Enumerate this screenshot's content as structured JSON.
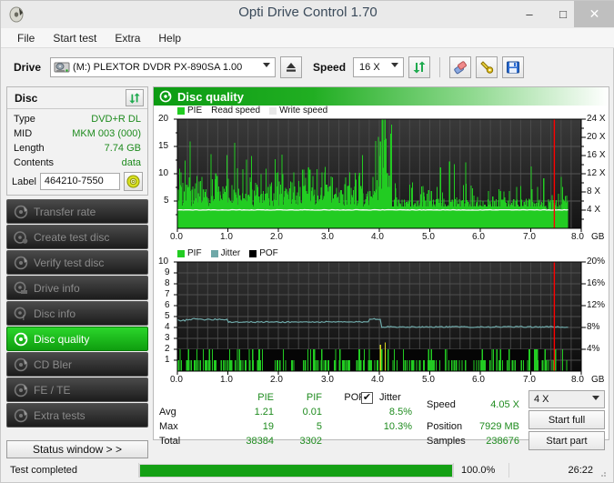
{
  "window": {
    "title": "Opti Drive Control 1.70",
    "app_icon": "disc-icon",
    "minimize": "–",
    "maximize": "□",
    "close": "✕"
  },
  "menu": {
    "items": [
      {
        "label": "File",
        "name": "menu-file"
      },
      {
        "label": "Start test",
        "name": "menu-start-test"
      },
      {
        "label": "Extra",
        "name": "menu-extra"
      },
      {
        "label": "Help",
        "name": "menu-help"
      }
    ]
  },
  "toolbar": {
    "drive_label": "Drive",
    "drive_value": "(M:)   PLEXTOR DVDR   PX-890SA 1.00",
    "eject_icon": "eject-icon",
    "speed_label": "Speed",
    "speed_value": "16 X",
    "refresh_icon": "refresh-icon",
    "erase_icon": "eraser-icon",
    "tools_icon": "wrench-icon",
    "save_icon": "floppy-save-icon"
  },
  "disc_panel": {
    "title": "Disc",
    "refresh_icon": "refresh-icon",
    "rows": [
      {
        "key": "Type",
        "value": "DVD+R DL"
      },
      {
        "key": "MID",
        "value": "MKM 003 (000)"
      },
      {
        "key": "Length",
        "value": "7.74 GB"
      },
      {
        "key": "Contents",
        "value": "data"
      }
    ],
    "label_key": "Label",
    "label_value": "464210-7550",
    "label_button_icon": "cd-disc-icon"
  },
  "sidebar": {
    "items": [
      {
        "label": "Transfer rate",
        "name": "sidebar-item-transfer-rate",
        "active": false
      },
      {
        "label": "Create test disc",
        "name": "sidebar-item-create-test-disc",
        "active": false
      },
      {
        "label": "Verify test disc",
        "name": "sidebar-item-verify-test-disc",
        "active": false
      },
      {
        "label": "Drive info",
        "name": "sidebar-item-drive-info",
        "active": false
      },
      {
        "label": "Disc info",
        "name": "sidebar-item-disc-info",
        "active": false
      },
      {
        "label": "Disc quality",
        "name": "sidebar-item-disc-quality",
        "active": true
      },
      {
        "label": "CD Bler",
        "name": "sidebar-item-cd-bler",
        "active": false
      },
      {
        "label": "FE / TE",
        "name": "sidebar-item-fe-te",
        "active": false
      },
      {
        "label": "Extra tests",
        "name": "sidebar-item-extra-tests",
        "active": false
      }
    ],
    "status_window_label": "Status window > >"
  },
  "main": {
    "header_title": "Disc quality",
    "header_icon": "disc-quality-icon"
  },
  "chart_data": [
    {
      "type": "bar",
      "name": "pie-chart",
      "title": "PIE",
      "legend": [
        {
          "label": "PIE",
          "color": "#22cc22"
        },
        {
          "label": "Read speed",
          "color": "#ffffff"
        },
        {
          "label": "Write speed",
          "color": "#e8e8e8"
        }
      ],
      "xlabel": "GB",
      "x_ticks": [
        "0.0",
        "1.0",
        "2.0",
        "3.0",
        "4.0",
        "5.0",
        "6.0",
        "7.0",
        "8.0"
      ],
      "xlim": [
        0,
        8.0
      ],
      "y_left_ticks": [
        "20",
        "15",
        "10",
        "5"
      ],
      "ylim": [
        0,
        20
      ],
      "ylabel": "",
      "y_right_ticks": [
        "24 X",
        "20 X",
        "16 X",
        "12 X",
        "8 X",
        "4 X"
      ],
      "y2lim": [
        0,
        24
      ],
      "grid": true,
      "background": "#1e1e1e",
      "data_end_gb": 7.74,
      "marker_gb": 7.86,
      "marker_color": "#ff0000",
      "read_speed_value_x": 4.05,
      "summary": {
        "avg": 1.21,
        "max": 19,
        "total": 38384
      }
    },
    {
      "type": "bar",
      "name": "pif-chart",
      "title": "PIF",
      "legend": [
        {
          "label": "PIF",
          "color": "#22cc22"
        },
        {
          "label": "Jitter",
          "color": "#6fa8a8"
        },
        {
          "label": "POF",
          "color": "#000000"
        }
      ],
      "xlabel": "GB",
      "x_ticks": [
        "0.0",
        "1.0",
        "2.0",
        "3.0",
        "4.0",
        "5.0",
        "6.0",
        "7.0",
        "8.0"
      ],
      "xlim": [
        0,
        8.0
      ],
      "y_left_ticks": [
        "10",
        "9",
        "8",
        "7",
        "6",
        "5",
        "4",
        "3",
        "2",
        "1"
      ],
      "ylim": [
        0,
        10
      ],
      "y_right_ticks": [
        "20%",
        "16%",
        "12%",
        "8%",
        "4%"
      ],
      "y2lim": [
        0,
        20
      ],
      "grid": true,
      "background": "#1e1e1e",
      "data_end_gb": 7.74,
      "marker_gb": 7.86,
      "marker_color": "#ff0000",
      "jitter_avg_pct": 8.5,
      "jitter_max_pct": 10.3,
      "summary": {
        "avg": 0.01,
        "max": 5,
        "total": 3302
      }
    }
  ],
  "stats": {
    "col_headers": [
      "PIE",
      "PIF",
      "POF",
      "Jitter"
    ],
    "row_labels": [
      "Avg",
      "Max",
      "Total"
    ],
    "pie": {
      "avg": "1.21",
      "max": "19",
      "total": "38384"
    },
    "pif": {
      "avg": "0.01",
      "max": "5",
      "total": "3302"
    },
    "pof": {
      "avg": "",
      "max": "",
      "total": ""
    },
    "jitter": {
      "avg": "8.5%",
      "max": "10.3%",
      "total": ""
    },
    "jitter_checked": true,
    "jitter_check_glyph": "✔",
    "speed_label": "Speed",
    "speed_value": "4.05 X",
    "position_label": "Position",
    "position_value": "7929 MB",
    "samples_label": "Samples",
    "samples_value": "238676",
    "speed_combo_value": "4 X",
    "start_full_label": "Start full",
    "start_part_label": "Start part"
  },
  "statusbar": {
    "status_text": "Test completed",
    "progress_percent": "100.0%",
    "progress_value": 100,
    "time": "26:22"
  },
  "colors": {
    "accent_green": "#1aa81a",
    "value_green": "#1e8b1e",
    "chart_green": "#22cc22",
    "jitter": "#6fa8a8",
    "marker_red": "#ff0000",
    "chart_bg": "#1e1e1e"
  }
}
